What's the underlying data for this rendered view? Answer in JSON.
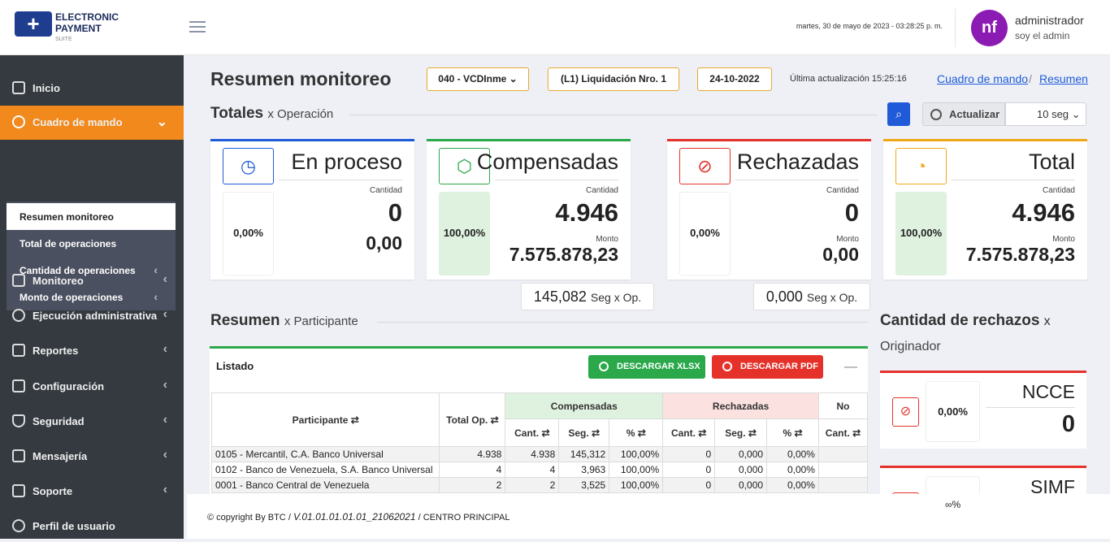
{
  "brand": {
    "line1": "ELECTRONIC",
    "line2": "PAYMENT",
    "line3": "SUITE"
  },
  "header": {
    "datetime": "martes, 30 de mayo de 2023 - 03:28:25 p. m.",
    "avatar_initials": "nf",
    "user_name": "administrador",
    "user_role": "soy el admin"
  },
  "sidebar": {
    "items": [
      {
        "label": "Inicio"
      },
      {
        "label": "Cuadro de mando"
      },
      {
        "label": "Monitoreo"
      },
      {
        "label": "Ejecución administrativa"
      },
      {
        "label": "Reportes"
      },
      {
        "label": "Configuración"
      },
      {
        "label": "Seguridad"
      },
      {
        "label": "Mensajería"
      },
      {
        "label": "Soporte"
      },
      {
        "label": "Perfil de usuario"
      }
    ],
    "submenu": [
      {
        "label": "Resumen monitoreo"
      },
      {
        "label": "Total de operaciones"
      },
      {
        "label": "Cantidad de operaciones"
      },
      {
        "label": "Monto de operaciones"
      }
    ]
  },
  "page": {
    "title": "Resumen monitoreo",
    "filter1": "040 - VCDInme",
    "filter2": "(L1) Liquidación Nro. 1",
    "filter3": "24-10-2022",
    "last_update": "Última actualización 15:25:16",
    "crumb1": "Cuadro de mando",
    "crumb_sep": "/",
    "crumb2": "Resumen"
  },
  "totales": {
    "title": "Totales",
    "suffix": "x Operación",
    "refresh_label": "Actualizar",
    "refresh_interval": "10 seg"
  },
  "cards": [
    {
      "title": "En proceso",
      "count_label": "Cantidad",
      "count": "0",
      "amount": "0,00",
      "amount_label": "",
      "pct": "0,00%",
      "color": "#1f5bd8"
    },
    {
      "title": "Compensadas",
      "count_label": "Cantidad",
      "count": "4.946",
      "amount_label": "Monto",
      "amount": "7.575.878,23",
      "pct": "100,00%",
      "color": "#2aa84a"
    },
    {
      "title": "Rechazadas",
      "count_label": "Cantidad",
      "count": "0",
      "amount_label": "Monto",
      "amount": "0,00",
      "pct": "0,00%",
      "color": "#e4322b"
    },
    {
      "title": "Total",
      "count_label": "Cantidad",
      "count": "4.946",
      "amount_label": "Monto",
      "amount": "7.575.878,23",
      "pct": "100,00%",
      "color": "#f0a818"
    }
  ],
  "seg": [
    {
      "value": "145,082",
      "unit": "Seg x Op."
    },
    {
      "value": "0,000",
      "unit": "Seg x Op."
    }
  ],
  "resumen": {
    "title": "Resumen",
    "suffix": "x Participante",
    "list_title": "Listado",
    "btn_xlsx": "DESCARGAR XLSX",
    "btn_pdf": "DESCARGAR PDF",
    "collapse": "—"
  },
  "table": {
    "h_participante": "Participante",
    "h_total": "Total Op.",
    "h_comp": "Compensadas",
    "h_rech": "Rechazadas",
    "h_next": "No",
    "sub": [
      "Cant.",
      "Seg.",
      "%",
      "Cant.",
      "Seg.",
      "%",
      "Cant."
    ],
    "rows": [
      [
        "0105 - Mercantil, C.A. Banco Universal",
        "4.938",
        "4.938",
        "145,312",
        "100,00%",
        "0",
        "0,000",
        "0,00%"
      ],
      [
        "0102 - Banco de Venezuela, S.A. Banco Universal",
        "4",
        "4",
        "3,963",
        "100,00%",
        "0",
        "0,000",
        "0,00%"
      ],
      [
        "0001 - Banco Central de Venezuela",
        "2",
        "2",
        "3,525",
        "100,00%",
        "0",
        "0,000",
        "0,00%"
      ]
    ]
  },
  "rechazos": {
    "title": "Cantidad de rechazos",
    "suffix": "x",
    "sub": "Originador",
    "cards": [
      {
        "name": "NCCE",
        "pct": "0,00%",
        "value": "0"
      },
      {
        "name": "SIMF",
        "pct": "∞%",
        "value": ""
      }
    ]
  },
  "footer": {
    "copyright": "©  copyright By BTC",
    "sep": "/",
    "version": "V.01.01.01.01.01_21062021",
    "center": "CENTRO PRINCIPAL",
    "pct": "∞%"
  }
}
